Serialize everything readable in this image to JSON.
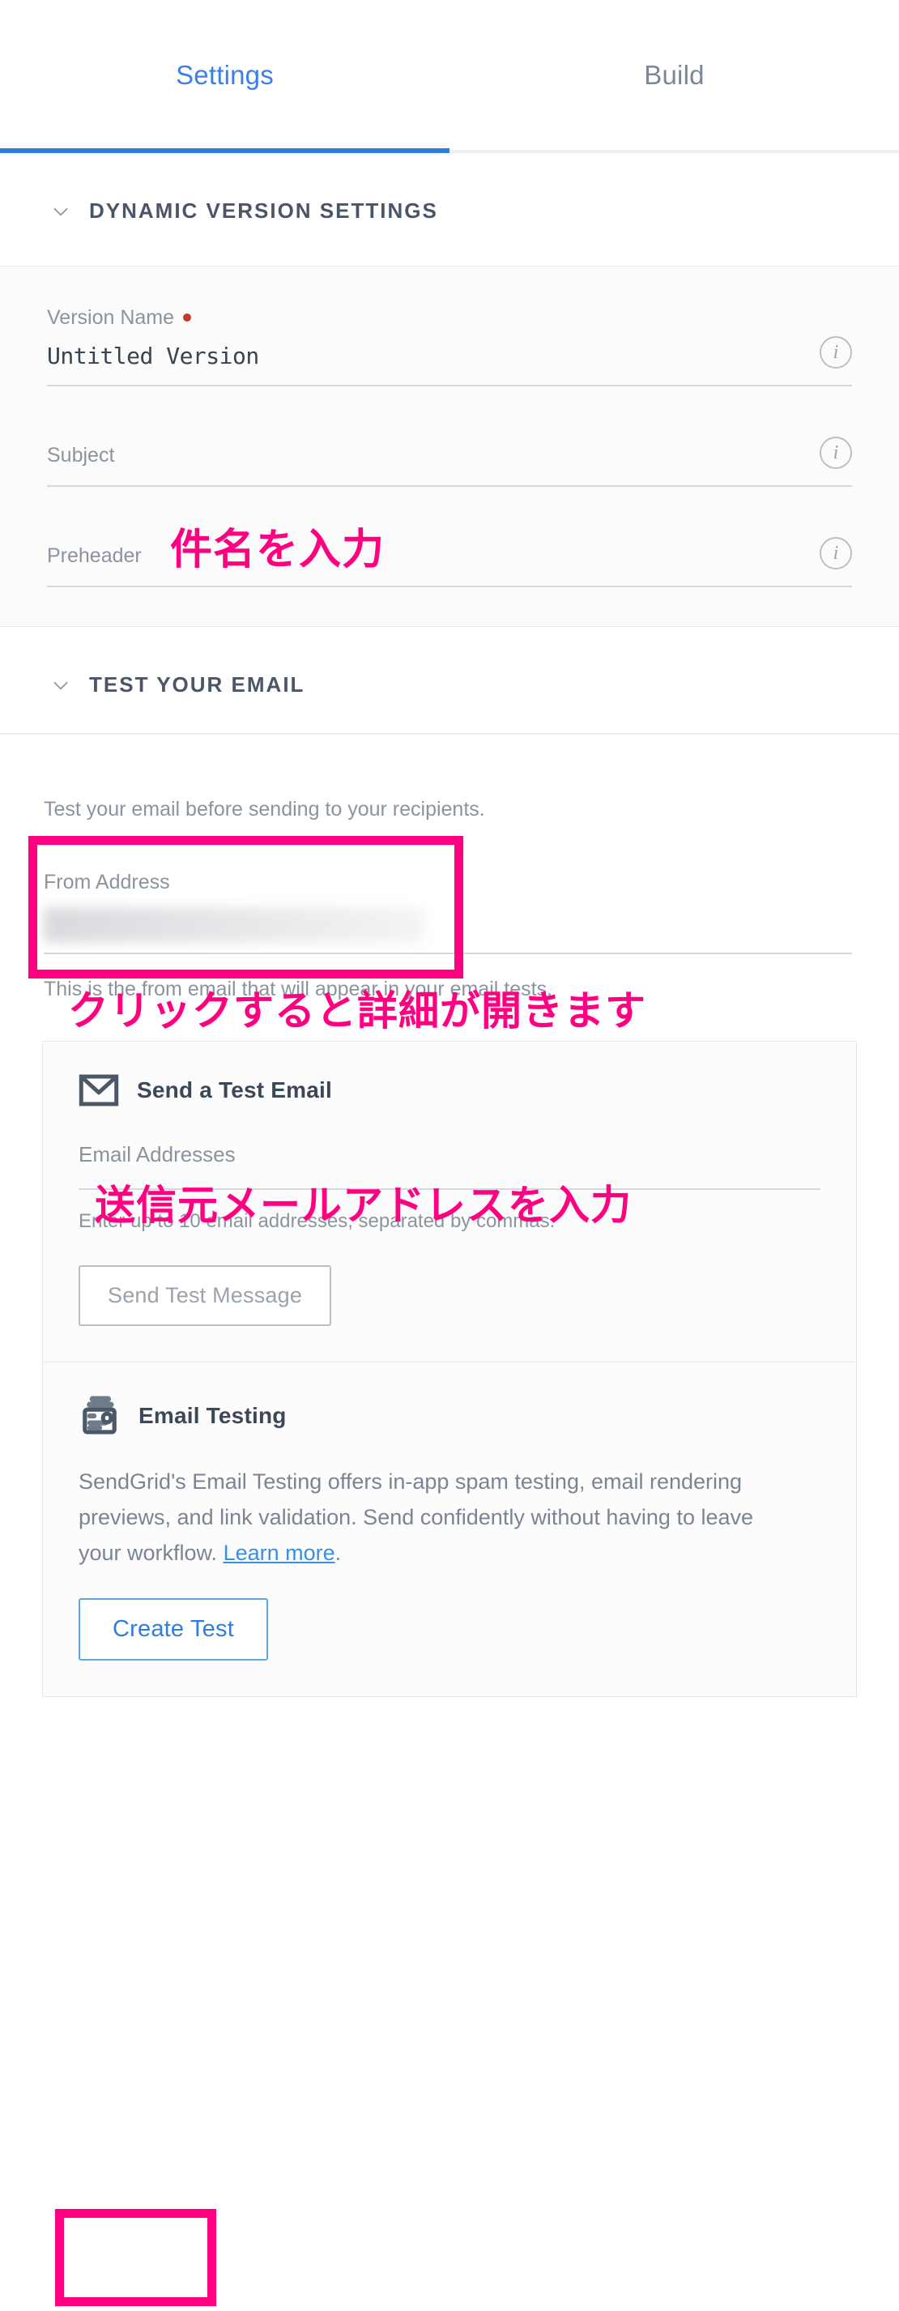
{
  "tabs": [
    {
      "label": "Settings",
      "active": true
    },
    {
      "label": "Build",
      "active": false
    }
  ],
  "dynamic_version_settings": {
    "header": "DYNAMIC VERSION SETTINGS",
    "chevron": "chevron-down-icon",
    "fields": [
      {
        "label": "Version Name",
        "required": true,
        "value": "Untitled Version",
        "info": "info-icon"
      },
      {
        "label": "Subject",
        "required": false,
        "value": "",
        "info": "info-icon"
      },
      {
        "label": "Preheader",
        "required": false,
        "value": "",
        "info": "info-icon"
      }
    ]
  },
  "test_your_email": {
    "header": "TEST YOUR EMAIL",
    "chevron": "chevron-down-icon",
    "description": "Test your email before sending to your recipients.",
    "from_address": {
      "label": "From Address",
      "value": "",
      "help": "This is the from email that will appear in your email tests."
    },
    "send_test_card": {
      "icon": "envelope-icon",
      "title": "Send a Test Email",
      "input_label": "Email Addresses",
      "input_value": "",
      "help": "Enter up to 10 email addresses, separated by commas.",
      "button": "Send Test Message",
      "button_disabled": true
    },
    "email_testing_card": {
      "icon": "document-stack-icon",
      "title": "Email Testing",
      "body": "SendGrid's Email Testing offers in-app spam testing, email rendering previews, and link validation. Send confidently without having to leave your workflow. ",
      "link": "Learn more",
      "body_end": ".",
      "button": "Create Test"
    }
  },
  "annotations": {
    "color": "#ff0080",
    "subject_note": "件名を入力",
    "test_email_note": "クリックすると詳細が開きます",
    "from_address_note": "送信元メールアドレスを入力"
  }
}
